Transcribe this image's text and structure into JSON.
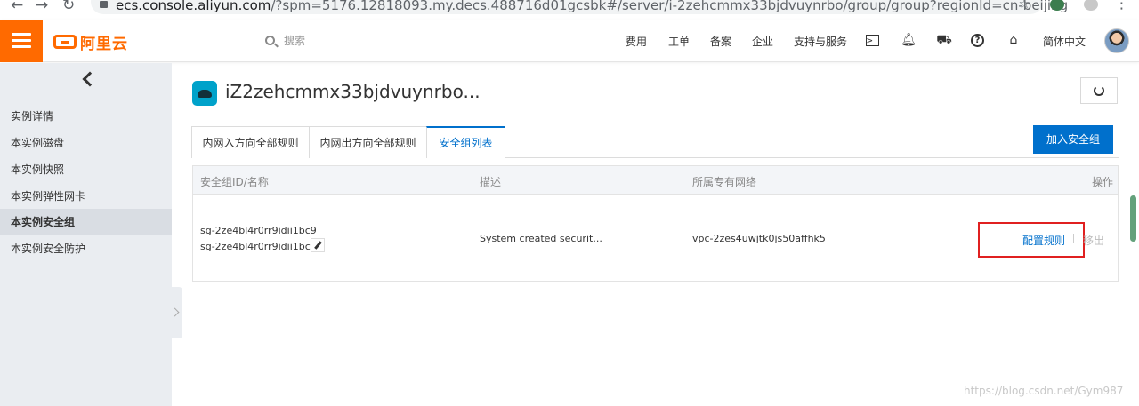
{
  "browser": {
    "url_domain": "ecs.console.aliyun.com",
    "url_path": "/?spm=5176.12818093.my.decs.488716d01gcsbk#/server/i-2zehcmmx33bjdvuynrbo/group/group?regionId=cn-beijing"
  },
  "header": {
    "logo_text": "阿里云",
    "search_placeholder": "搜索",
    "links": [
      "费用",
      "工单",
      "备案",
      "企业",
      "支持与服务"
    ],
    "language": "简体中文"
  },
  "sidebar": {
    "items": [
      {
        "label": "实例详情",
        "active": false
      },
      {
        "label": "本实例磁盘",
        "active": false
      },
      {
        "label": "本实例快照",
        "active": false
      },
      {
        "label": "本实例弹性网卡",
        "active": false
      },
      {
        "label": "本实例安全组",
        "active": true
      },
      {
        "label": "本实例安全防护",
        "active": false
      }
    ]
  },
  "page": {
    "title": "iZ2zehcmmx33bjdvuynrbo...",
    "tabs": [
      {
        "label": "内网入方向全部规则",
        "active": false
      },
      {
        "label": "内网出方向全部规则",
        "active": false
      },
      {
        "label": "安全组列表",
        "active": true
      }
    ],
    "add_button": "加入安全组"
  },
  "table": {
    "columns": [
      "安全组ID/名称",
      "描述",
      "所属专有网络",
      "操作"
    ],
    "rows": [
      {
        "id": "sg-2ze4bl4r0rr9idii1bc9",
        "name": "sg-2ze4bl4r0rr9idii1bc...",
        "description": "System created securit...",
        "vpc": "vpc-2zes4uwjtk0js50affhk5",
        "action_config": "配置规则",
        "action_remove": "移出"
      }
    ]
  },
  "watermark": "https://blog.csdn.net/Gym987",
  "colors": {
    "brand": "#ff6a00",
    "accent": "#0070cc",
    "highlight": "#e02020"
  }
}
